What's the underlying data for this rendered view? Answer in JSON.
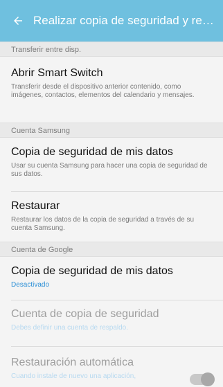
{
  "appbar": {
    "title": "Realizar copia de seguridad y rest...",
    "back_icon": "arrow-back-icon"
  },
  "sections": [
    {
      "header": "Transferir entre disp.",
      "items": [
        {
          "title": "Abrir Smart Switch",
          "subtitle": "Transferir desde el dispositivo anterior contenido, como imágenes, contactos, elementos del calendario y mensajes."
        }
      ]
    },
    {
      "header": "Cuenta Samsung",
      "items": [
        {
          "title": "Copia de seguridad de mis datos",
          "subtitle": "Usar su cuenta Samsung para hacer una copia de seguridad de sus datos."
        },
        {
          "title": "Restaurar",
          "subtitle": "Restaurar los datos de la copia de seguridad a través de su cuenta Samsung."
        }
      ]
    },
    {
      "header": "Cuenta de Google",
      "items": [
        {
          "title": "Copia de seguridad de mis datos",
          "subtitle": "Desactivado"
        },
        {
          "title": "Cuenta de copia de seguridad",
          "subtitle": "Debes definir una cuenta de respaldo."
        },
        {
          "title": "Restauración automática",
          "subtitle": "Cuando instale de nuevo una aplicación,",
          "toggle_on": true
        }
      ]
    }
  ],
  "colors": {
    "appbar": "#6fc0df",
    "accent_text": "#2b8fd6"
  }
}
